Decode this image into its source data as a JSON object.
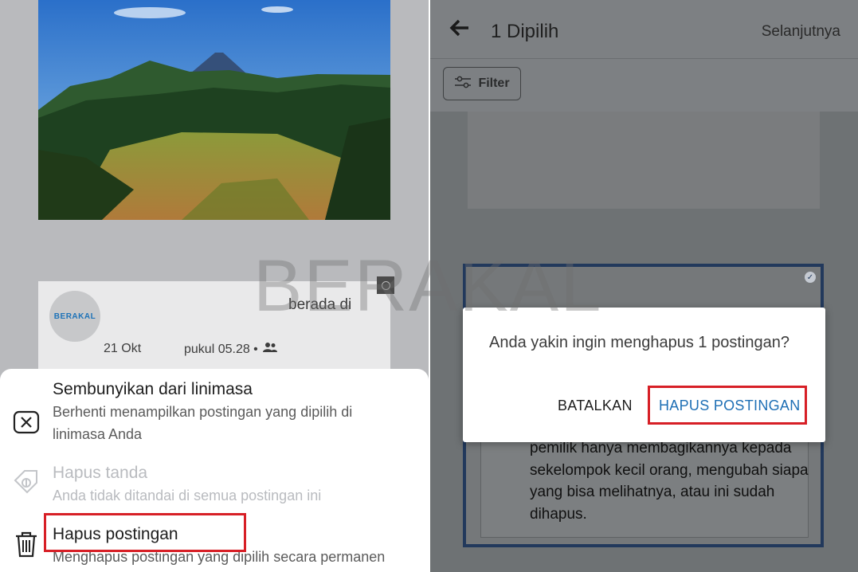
{
  "left": {
    "post": {
      "avatar_text": "BERAKAL",
      "text": "berada di",
      "date": "21 Okt",
      "time": "pukul 05.28 •"
    },
    "menu": {
      "hide": {
        "title": "Sembunyikan dari linimasa",
        "desc": "Berhenti menampilkan postingan yang dipilih di linimasa Anda",
        "icon": "close-box-icon"
      },
      "untag": {
        "title": "Hapus tanda",
        "desc": "Anda tidak ditandai di semua postingan ini",
        "icon": "tag-icon"
      },
      "delete": {
        "title": "Hapus postingan",
        "desc": "Menghapus postingan yang dipilih secara permanen",
        "icon": "trash-icon"
      }
    }
  },
  "right": {
    "header": {
      "title": "1 Dipilih",
      "next": "Selanjutnya"
    },
    "filter_label": "Filter",
    "post_text": "pemilik hanya membagikannya kepada sekelompok kecil orang, mengubah siapa yang bisa melihatnya, atau ini sudah dihapus.",
    "dialog": {
      "message": "Anda yakin ingin menghapus 1 postingan?",
      "cancel": "BATALKAN",
      "confirm": "HAPUS POSTINGAN"
    }
  },
  "watermark": "BERAKAL",
  "colors": {
    "highlight": "#d71f26",
    "link": "#1e6fb5",
    "selection": "#22395c"
  }
}
